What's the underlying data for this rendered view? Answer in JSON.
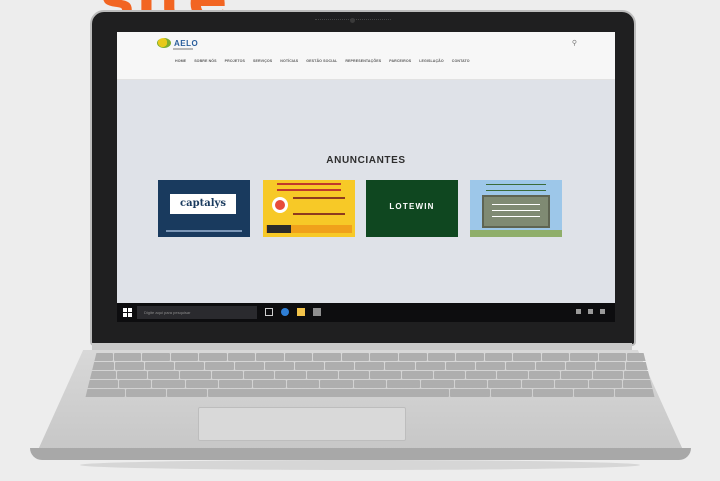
{
  "page": {
    "title_fragment": "site"
  },
  "website": {
    "logo_text": "AELO",
    "header_search_icon": "search-icon",
    "menu": [
      "HOME",
      "SOBRE NÓS",
      "PROJETOS",
      "SERVIÇOS",
      "NOTÍCIAS",
      "GESTÃO SOCIAL",
      "REPRESENTAÇÕES",
      "PARCEIROS",
      "LEGISLAÇÃO",
      "CONTATO"
    ],
    "section_title": "ANUNCIANTES",
    "advertisers": [
      {
        "name": "captalys",
        "bg": "#193a5e"
      },
      {
        "name": "",
        "bg": "#f7c927"
      },
      {
        "name": "LOTEWIN",
        "bg": "#0f4720"
      },
      {
        "name": "",
        "bg": "#9dc7e9"
      }
    ]
  },
  "taskbar": {
    "start_icon": "windows-icon",
    "search_placeholder": "Digite aqui para pesquisar",
    "clock_time": "",
    "clock_date": ""
  },
  "colors": {
    "accent": "#f26522",
    "screen_bg": "#dfe2e8",
    "taskbar": "#0d0d0f"
  }
}
